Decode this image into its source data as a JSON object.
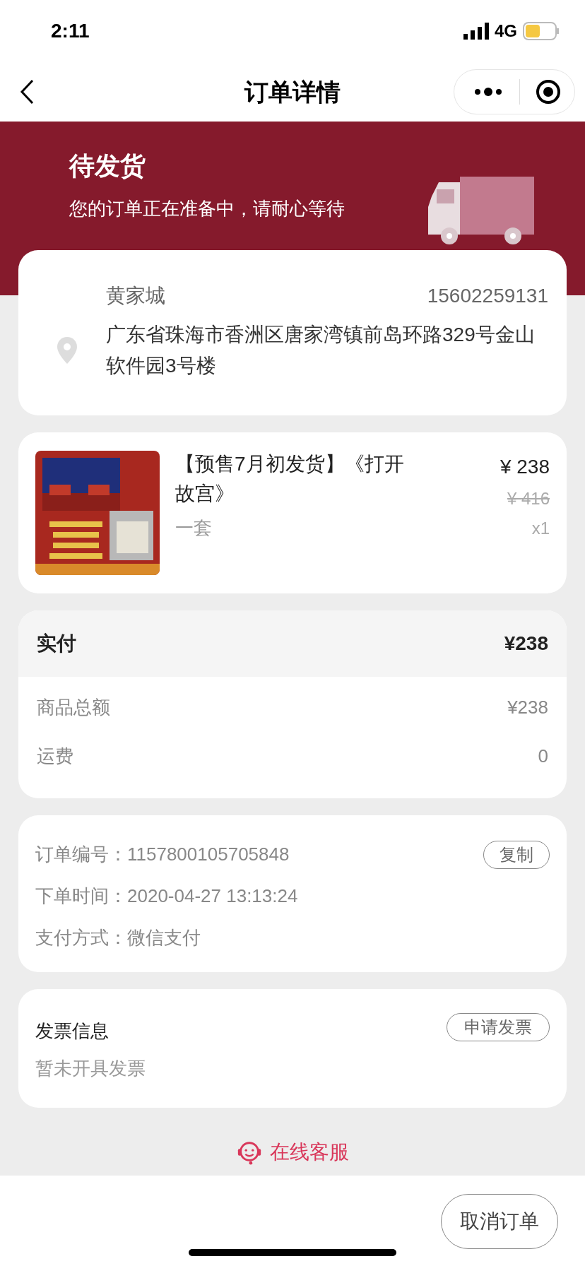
{
  "status_bar": {
    "time": "2:11",
    "network": "4G"
  },
  "nav": {
    "title": "订单详情"
  },
  "banner": {
    "title": "待发货",
    "subtitle": "您的订单正在准备中，请耐心等待"
  },
  "address": {
    "name": "黄家城",
    "phone": "15602259131",
    "address": "广东省珠海市香洲区唐家湾镇前岛环路329号金山软件园3号楼"
  },
  "product": {
    "title": "【预售7月初发货】《打开故宫》",
    "spec": "一套",
    "price": "¥ 238",
    "original_price": "¥ 416",
    "quantity": "x1"
  },
  "payment": {
    "label": "实付",
    "amount": "¥238",
    "rows": [
      {
        "label": "商品总额",
        "value": "¥238"
      },
      {
        "label": "运费",
        "value": "0"
      }
    ]
  },
  "order_info": {
    "rows": [
      {
        "label": "订单编号：",
        "value": "1157800105705848"
      },
      {
        "label": "下单时间：",
        "value": "2020-04-27 13:13:24"
      },
      {
        "label": "支付方式：",
        "value": "微信支付"
      }
    ],
    "copy_button": "复制"
  },
  "invoice": {
    "title": "发票信息",
    "status": "暂未开具发票",
    "button": "申请发票"
  },
  "support": {
    "label": "在线客服"
  },
  "bottom_bar": {
    "buttons": [
      "取消订单"
    ]
  }
}
